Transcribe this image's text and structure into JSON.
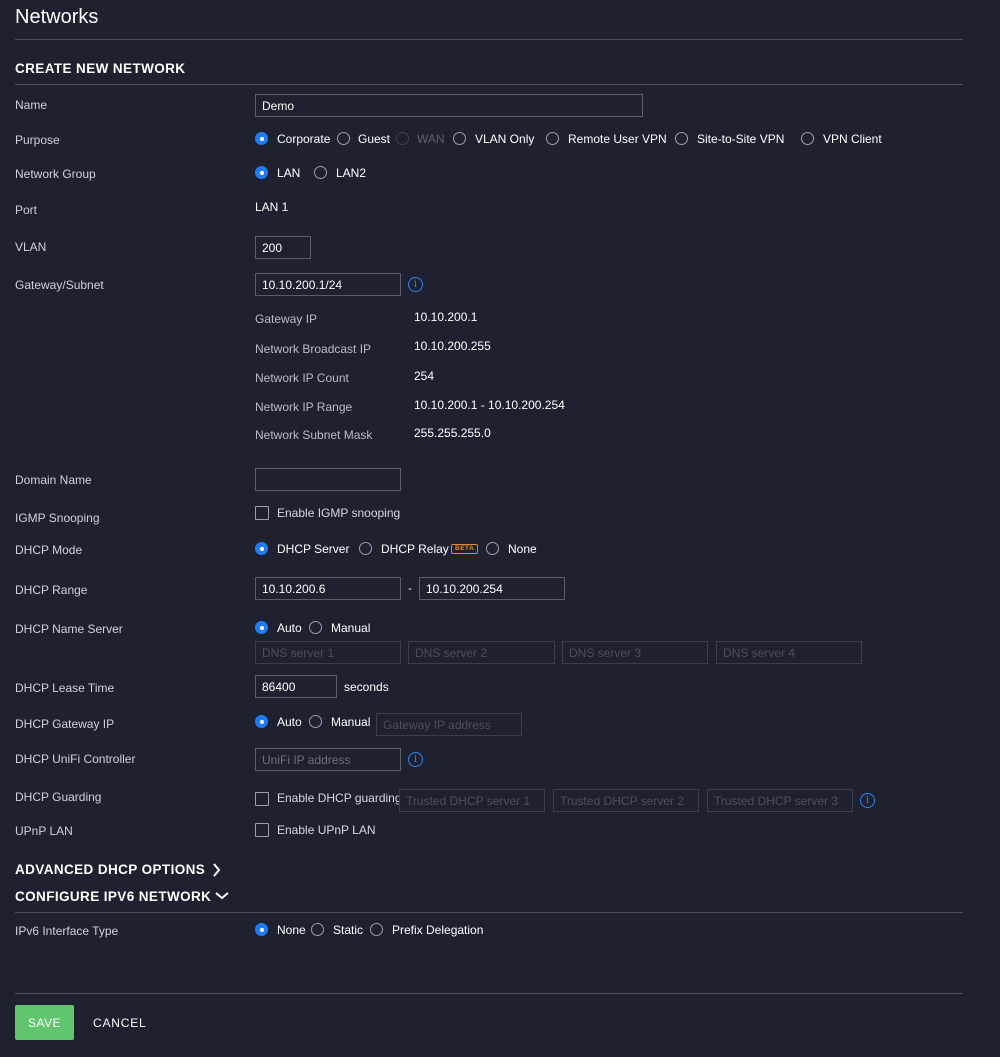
{
  "page_title": "Networks",
  "section_title": "CREATE NEW NETWORK",
  "labels": {
    "name": "Name",
    "purpose": "Purpose",
    "network_group": "Network Group",
    "port": "Port",
    "vlan": "VLAN",
    "gateway_subnet": "Gateway/Subnet",
    "domain_name": "Domain Name",
    "igmp_snooping": "IGMP Snooping",
    "dhcp_mode": "DHCP Mode",
    "dhcp_range": "DHCP Range",
    "dhcp_name_server": "DHCP Name Server",
    "dhcp_lease_time": "DHCP Lease Time",
    "dhcp_gateway_ip": "DHCP Gateway IP",
    "dhcp_unifi_controller": "DHCP UniFi Controller",
    "dhcp_guarding": "DHCP Guarding",
    "upnp_lan": "UPnP LAN",
    "ipv6_interface_type": "IPv6 Interface Type"
  },
  "name_value": "Demo",
  "purpose_options": [
    {
      "label": "Corporate",
      "selected": true
    },
    {
      "label": "Guest",
      "selected": false
    },
    {
      "label": "WAN",
      "selected": false,
      "disabled": true
    },
    {
      "label": "VLAN Only",
      "selected": false
    },
    {
      "label": "Remote User VPN",
      "selected": false
    },
    {
      "label": "Site-to-Site VPN",
      "selected": false
    },
    {
      "label": "VPN Client",
      "selected": false
    }
  ],
  "network_group_options": [
    {
      "label": "LAN",
      "selected": true
    },
    {
      "label": "LAN2",
      "selected": false
    }
  ],
  "port_value": "LAN 1",
  "vlan_value": "200",
  "gateway_subnet_value": "10.10.200.1/24",
  "subnet_info": [
    {
      "label": "Gateway IP",
      "value": "10.10.200.1"
    },
    {
      "label": "Network Broadcast IP",
      "value": "10.10.200.255"
    },
    {
      "label": "Network IP Count",
      "value": "254"
    },
    {
      "label": "Network IP Range",
      "value": "10.10.200.1 - 10.10.200.254"
    },
    {
      "label": "Network Subnet Mask",
      "value": "255.255.255.0"
    }
  ],
  "domain_name_value": "",
  "igmp_checkbox_label": "Enable IGMP snooping",
  "dhcp_mode_options": [
    {
      "label": "DHCP Server",
      "selected": true
    },
    {
      "label": "DHCP Relay",
      "selected": false
    },
    {
      "label": "None",
      "selected": false
    }
  ],
  "beta_badge": "BETA",
  "dhcp_range_start": "10.10.200.6",
  "dhcp_range_separator": "-",
  "dhcp_range_end": "10.10.200.254",
  "name_server_options": [
    {
      "label": "Auto",
      "selected": true
    },
    {
      "label": "Manual",
      "selected": false
    }
  ],
  "dns_placeholders": [
    "DNS server 1",
    "DNS server 2",
    "DNS server 3",
    "DNS server 4"
  ],
  "lease_time_value": "86400",
  "lease_time_unit": "seconds",
  "gateway_ip_options": [
    {
      "label": "Auto",
      "selected": true
    },
    {
      "label": "Manual",
      "selected": false
    }
  ],
  "gateway_ip_placeholder": "Gateway IP address",
  "unifi_ip_placeholder": "UniFi IP address",
  "dhcp_guarding_checkbox_label": "Enable DHCP guarding",
  "trusted_dhcp_placeholders": [
    "Trusted DHCP server 1",
    "Trusted DHCP server 2",
    "Trusted DHCP server 3"
  ],
  "upnp_checkbox_label": "Enable UPnP LAN",
  "advanced_dhcp_title": "ADVANCED DHCP OPTIONS",
  "configure_ipv6_title": "CONFIGURE IPV6 NETWORK",
  "ipv6_options": [
    {
      "label": "None",
      "selected": true
    },
    {
      "label": "Static",
      "selected": false
    },
    {
      "label": "Prefix Delegation",
      "selected": false
    }
  ],
  "info_glyph": "i",
  "buttons": {
    "save": "SAVE",
    "cancel": "CANCEL"
  },
  "colors": {
    "background": "#1e2230",
    "accent": "#1f7cf5",
    "save": "#63c46e",
    "beta": "#e08b2a"
  },
  "icons": {
    "info": "info-icon",
    "chevron_right": "chevron-right-icon",
    "chevron_down": "chevron-down-icon"
  }
}
